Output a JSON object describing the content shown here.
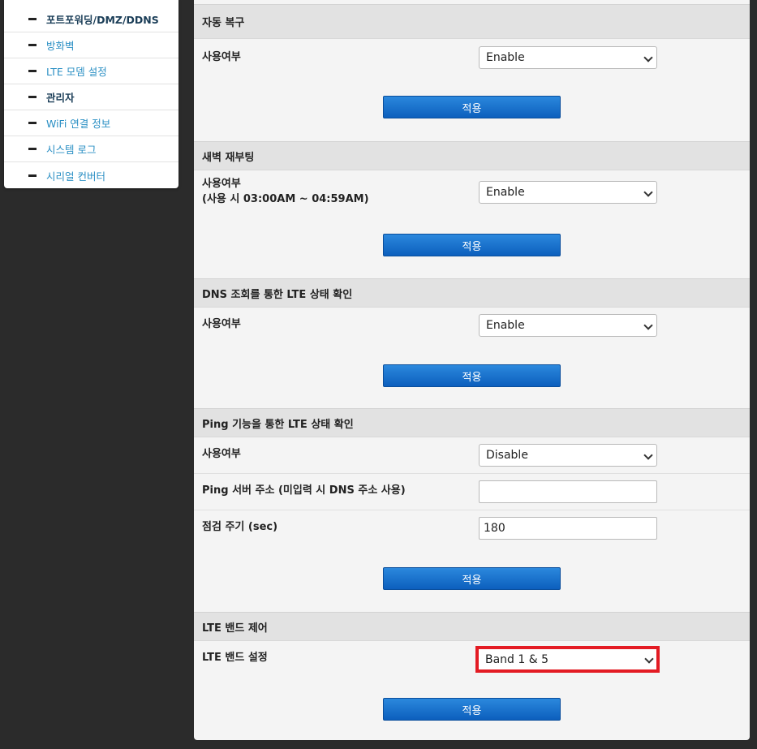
{
  "sidebar": {
    "items": [
      {
        "label": "포트포워딩/DMZ/DDNS",
        "bold": true
      },
      {
        "label": "방화벽",
        "bold": false
      },
      {
        "label": "LTE 모뎀 설정",
        "bold": false
      },
      {
        "label": "관리자",
        "bold": true
      },
      {
        "label": "WiFi 연결 정보",
        "bold": false
      },
      {
        "label": "시스템 로그",
        "bold": false
      },
      {
        "label": "시리얼 컨버터",
        "bold": false
      }
    ]
  },
  "sections": {
    "auto_recovery": {
      "title": "자동 복구",
      "use_label": "사용여부",
      "use_value": "Enable",
      "apply_label": "적용"
    },
    "dawn_reboot": {
      "title": "새벽 재부팅",
      "use_label": "사용여부",
      "use_note": "(사용 시 03:00AM ~ 04:59AM)",
      "use_value": "Enable",
      "apply_label": "적용"
    },
    "dns_check": {
      "title": "DNS 조회를 통한 LTE 상태 확인",
      "use_label": "사용여부",
      "use_value": "Enable",
      "apply_label": "적용"
    },
    "ping_check": {
      "title": "Ping 기능을 통한 LTE 상태 확인",
      "use_label": "사용여부",
      "use_value": "Disable",
      "server_label": "Ping 서버 주소 (미입력 시 DNS 주소 사용)",
      "server_value": "",
      "interval_label": "점검 주기 (sec)",
      "interval_value": "180",
      "apply_label": "적용"
    },
    "lte_band": {
      "title": "LTE 밴드 제어",
      "band_label": "LTE 밴드 설정",
      "band_value": "Band 1 & 5",
      "apply_label": "적용"
    }
  },
  "colors": {
    "highlight": "#e31b23",
    "button": "#1a6fce",
    "link": "#2a8fc4"
  }
}
